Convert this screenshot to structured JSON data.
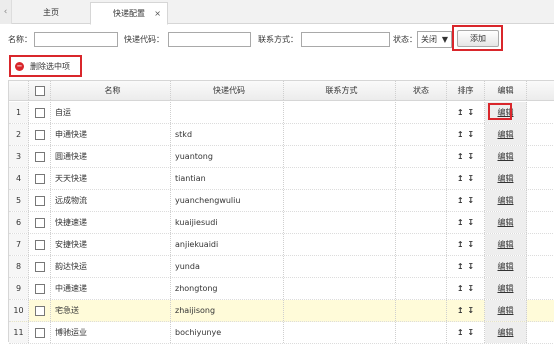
{
  "tabs": {
    "scroll_left": "‹",
    "home": "主页",
    "active": "快递配置",
    "close": "×"
  },
  "search": {
    "name_label": "名称：",
    "name_value": "",
    "code_label": "快递代码：",
    "code_value": "",
    "contact_label": "联系方式：",
    "contact_value": "",
    "status_label": "状态：",
    "status_selected": "关闭",
    "add_label": "添加"
  },
  "toolbar": {
    "delete_label": "删除选中项",
    "delete_icon": "minus-circle-icon"
  },
  "grid": {
    "columns": {
      "name": "名称",
      "code": "快递代码",
      "contact": "联系方式",
      "status": "状态",
      "sort": "排序",
      "edit": "编辑"
    },
    "sort_up": "↥",
    "sort_down": "↧",
    "edit_label": "编辑",
    "rows": [
      {
        "num": "1",
        "name": "自运",
        "code": "",
        "contact": "",
        "status": ""
      },
      {
        "num": "2",
        "name": "申通快递",
        "code": "stkd",
        "contact": "",
        "status": ""
      },
      {
        "num": "3",
        "name": "圆通快递",
        "code": "yuantong",
        "contact": "",
        "status": ""
      },
      {
        "num": "4",
        "name": "天天快递",
        "code": "tiantian",
        "contact": "",
        "status": ""
      },
      {
        "num": "5",
        "name": "远成物流",
        "code": "yuanchengwuliu",
        "contact": "",
        "status": ""
      },
      {
        "num": "6",
        "name": "快捷速递",
        "code": "kuaijiesudi",
        "contact": "",
        "status": ""
      },
      {
        "num": "7",
        "name": "安捷快递",
        "code": "anjiekuaidi",
        "contact": "",
        "status": ""
      },
      {
        "num": "8",
        "name": "韵达快运",
        "code": "yunda",
        "contact": "",
        "status": ""
      },
      {
        "num": "9",
        "name": "中通速递",
        "code": "zhongtong",
        "contact": "",
        "status": ""
      },
      {
        "num": "10",
        "name": "宅急送",
        "code": "zhaijisong",
        "contact": "",
        "status": ""
      },
      {
        "num": "11",
        "name": "博驰运业",
        "code": "bochiyunye",
        "contact": "",
        "status": ""
      }
    ],
    "selected_row": "10"
  },
  "colors": {
    "highlight_border": "#d9262b",
    "selected_row_bg": "#fffbd9",
    "header_bg": "#ececec"
  }
}
